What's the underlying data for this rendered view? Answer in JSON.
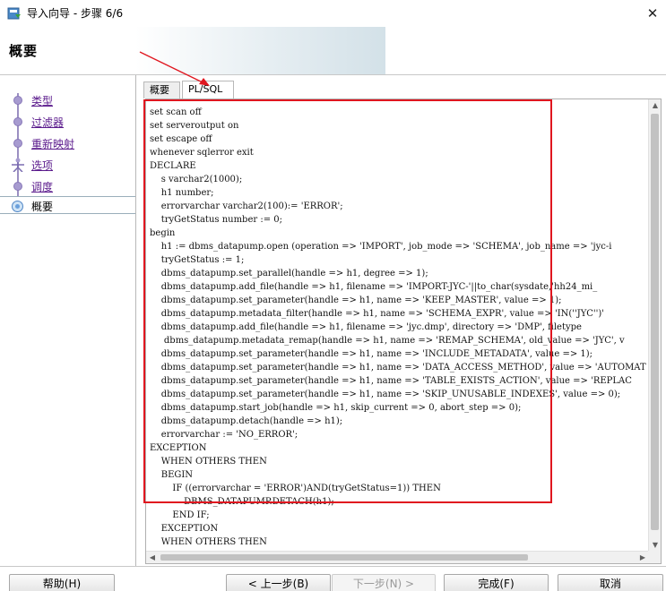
{
  "window": {
    "title": "导入向导 - 步骤 6/6",
    "close_glyph": "✕",
    "icon": "import-wizard-icon"
  },
  "header": {
    "title": "概要"
  },
  "steps": [
    {
      "label": "类型",
      "current": false
    },
    {
      "label": "过滤器",
      "current": false
    },
    {
      "label": "重新映射",
      "current": false
    },
    {
      "label": "选项",
      "current": false
    },
    {
      "label": "调度",
      "current": false
    },
    {
      "label": "概要",
      "current": true
    }
  ],
  "tabs": [
    {
      "label": "概要",
      "selected": false
    },
    {
      "label": "PL/SQL",
      "selected": true
    }
  ],
  "code_lines": [
    "set scan off",
    "set serveroutput on",
    "set escape off",
    "whenever sqlerror exit",
    "DECLARE",
    "    s varchar2(1000);",
    "    h1 number;",
    "    errorvarchar varchar2(100):= 'ERROR';",
    "    tryGetStatus number := 0;",
    "begin",
    "    h1 := dbms_datapump.open (operation => 'IMPORT', job_mode => 'SCHEMA', job_name => 'jyc-i",
    "    tryGetStatus := 1;",
    "    dbms_datapump.set_parallel(handle => h1, degree => 1);",
    "    dbms_datapump.add_file(handle => h1, filename => 'IMPORT-JYC-'||to_char(sysdate,'hh24_mi_",
    "    dbms_datapump.set_parameter(handle => h1, name => 'KEEP_MASTER', value => 1);",
    "    dbms_datapump.metadata_filter(handle => h1, name => 'SCHEMA_EXPR', value => 'IN(''JYC'')'",
    "    dbms_datapump.add_file(handle => h1, filename => 'jyc.dmp', directory => 'DMP', filetype",
    "     dbms_datapump.metadata_remap(handle => h1, name => 'REMAP_SCHEMA', old_value => 'JYC', v",
    "    dbms_datapump.set_parameter(handle => h1, name => 'INCLUDE_METADATA', value => 1);",
    "    dbms_datapump.set_parameter(handle => h1, name => 'DATA_ACCESS_METHOD', value => 'AUTOMAT",
    "    dbms_datapump.set_parameter(handle => h1, name => 'TABLE_EXISTS_ACTION', value => 'REPLAC",
    "    dbms_datapump.set_parameter(handle => h1, name => 'SKIP_UNUSABLE_INDEXES', value => 0);",
    "    dbms_datapump.start_job(handle => h1, skip_current => 0, abort_step => 0);",
    "    dbms_datapump.detach(handle => h1);",
    "    errorvarchar := 'NO_ERROR';",
    "EXCEPTION",
    "    WHEN OTHERS THEN",
    "    BEGIN",
    "        IF ((errorvarchar = 'ERROR')AND(tryGetStatus=1)) THEN",
    "            DBMS_DATAPUMP.DETACH(h1);",
    "        END IF;",
    "    EXCEPTION",
    "    WHEN OTHERS THEN"
  ],
  "buttons": {
    "help": "帮助(H)",
    "back": "< 上一步(B)",
    "next": "下一步(N) >",
    "finish": "完成(F)",
    "cancel": "取消"
  },
  "colors": {
    "annotation": "#e0161f",
    "step_link": "#5a1a8c"
  }
}
